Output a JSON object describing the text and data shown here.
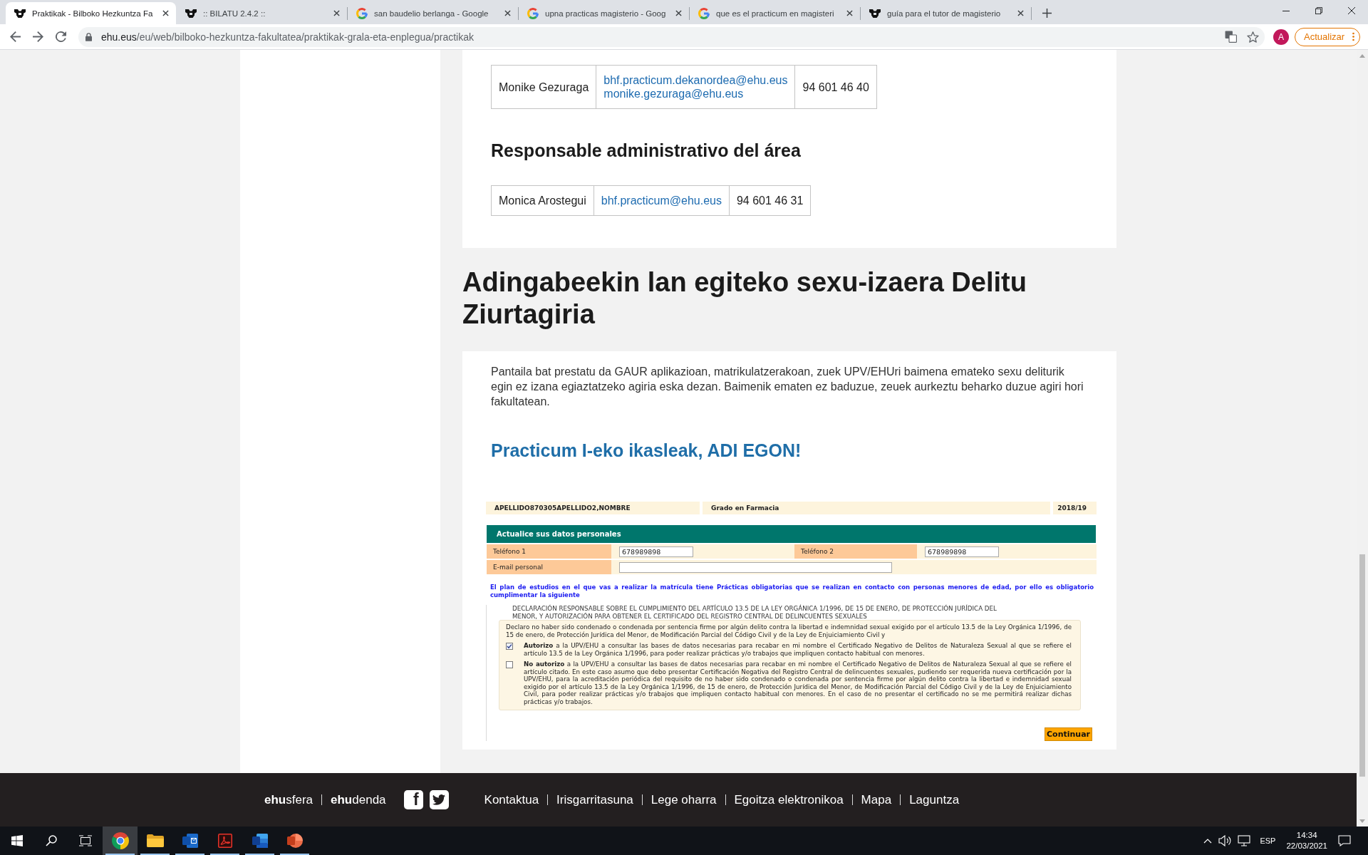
{
  "browser": {
    "tabs": [
      {
        "title": "Praktikak - Bilboko Hezkuntza Fa",
        "kind": "emblem",
        "selected": true
      },
      {
        "title": ":: BILATU 2.4.2 ::",
        "kind": "emblem",
        "selected": false
      },
      {
        "title": "san baudelio berlanga - Google",
        "kind": "google",
        "selected": false
      },
      {
        "title": "upna practicas magisterio - Goog",
        "kind": "google",
        "selected": false
      },
      {
        "title": "que es el practicum en magisteri",
        "kind": "google",
        "selected": false
      },
      {
        "title": "guía para el tutor de magisterio",
        "kind": "emblem",
        "selected": false
      }
    ],
    "address": {
      "host": "ehu.eus",
      "path": "/eu/web/bilboko-hezkuntza-fakultatea/praktikak-grala-eta-enplegua/practikak"
    },
    "profile_initial": "A",
    "update_button": "Actualizar"
  },
  "contacts_card": {
    "contact_rows": [
      {
        "name": "Monike Gezuraga",
        "emails": [
          "bhf.practicum.dekanordea@ehu.eus",
          "monike.gezuraga@ehu.eus"
        ],
        "phone": "94 601 46 40"
      }
    ],
    "admin_heading": "Responsable administrativo del área",
    "admin_rows": [
      {
        "name": "Monica Arostegui",
        "emails": [
          "bhf.practicum@ehu.eus"
        ],
        "phone": "94 601 46 31"
      }
    ]
  },
  "section_title": "Adingabeekin lan egiteko sexu-izaera Delitu Ziurtagiria",
  "certificate_card": {
    "intro": "Pantaila bat prestatu da GAUR aplikazioan, matrikulatzerakoan, zuek UPV/EHUri baimena emateko sexu deliturik egin ez izana egiaztatzeko agiria eska dezan. Baimenik ematen ez baduzue, zeuek aurkeztu beharko duzue agiri hori fakultatean.",
    "notice": "Practicum I-eko ikasleak, ADI EGON!",
    "form_screenshot": {
      "header": [
        "APELLIDO870305APELLIDO2,NOMBRE",
        "Grado en Farmacia",
        "2018/19"
      ],
      "section_bar": "Actualice sus datos personales",
      "field_rows": [
        {
          "fields": [
            {
              "label": "Teléfono 1",
              "value": "678989898"
            },
            {
              "label": "Teléfono 2",
              "value": "678989898"
            }
          ]
        },
        {
          "fields": [
            {
              "label": "E-mail personal"
            }
          ]
        }
      ],
      "obligation_note": "El plan de estudios en el que vas a realizar la matrícula tiene Prácticas obligatorias que se realizan en contacto con personas menores de edad, por ello es obligatorio cumplimentar la siguiente",
      "declaration": {
        "title": "DECLARACIÓN RESPONSABLE SOBRE EL CUMPLIMIENTO DEL ARTÍCULO 13.5 DE LA LEY ORGÁNICA 1/1996, DE 15 DE ENERO, DE PROTECCIÓN JURÍDICA DEL MENOR, Y AUTORIZACIÓN PARA OBTENER EL CERTIFICADO DEL REGISTRO CENTRAL DE DELINCUENTES SEXUALES",
        "statement": "Declaro no haber sido condenado o condenada por sentencia firme por algún delito contra la libertad e indemnidad sexual exigido por el artículo 13.5 de la Ley Orgánica 1/1996, de 15 de enero, de Protección Jurídica del Menor, de Modificación Parcial del Código Civil y de la Ley de Enjuiciamiento Civil y",
        "options": [
          {
            "text": "**Autorizo** a la UPV/EHU a consultar las bases de datos necesarias para recabar en mi nombre el Certificado Negativo de Delitos de Naturaleza Sexual al que se refiere el artículo 13.5 de la Ley Orgánica 1/1996, para poder realizar prácticas y/o trabajos que impliquen contacto habitual con menores.",
            "checked": true
          },
          {
            "text": "**No autorizo** a la UPV/EHU a consultar las bases de datos necesarias para recabar en mi nombre el Certificado Negativo de Delitos de Naturaleza Sexual al que se refiere el artículo citado. En este caso asumo que debo presentar Certificación Negativa del Registro Central de delincuentes sexuales, pudiendo ser requerida nueva certificación por la UPV/EHU, para la acreditación periódica del requisito de no haber sido condenado o condenada por sentencia firme por algún delito contra la libertad e indemnidad sexual exigido por el artículo 13.5 de la Ley Orgánica 1/1996, de 15 de enero, de Protección Jurídica del Menor, de Modificación Parcial del Código Civil y de la Ley de Enjuiciamiento Civil, para poder realizar prácticas y/o trabajos que impliquen contacto habitual con menores. En el caso de no presentar el certificado no se me permitirá realizar dichas prácticas y/o trabajos.",
            "checked": false
          }
        ]
      },
      "continue_button": "Continuar"
    }
  },
  "footer": {
    "brand_links": [
      "**ehu**sfera",
      "**ehu**denda"
    ],
    "social": [
      {
        "kind": "facebook",
        "letter": "f"
      },
      {
        "kind": "twitter"
      }
    ],
    "links": [
      "Kontaktua",
      "Irisgarritasuna",
      "Lege oharra",
      "Egoitza elektronikoa",
      "Mapa",
      "Laguntza"
    ]
  },
  "taskbar": {
    "apps": [
      {
        "kind": "browser",
        "selected": true,
        "running": true
      },
      {
        "kind": "folder",
        "selected": false,
        "running": true
      },
      {
        "kind": "mail",
        "selected": false,
        "running": true
      },
      {
        "kind": "pdf",
        "selected": false,
        "running": true
      },
      {
        "kind": "document",
        "selected": false,
        "running": true
      },
      {
        "kind": "slides",
        "selected": false,
        "running": true
      }
    ],
    "language": "ESP",
    "time": "14:34",
    "date": "22/03/2021"
  }
}
